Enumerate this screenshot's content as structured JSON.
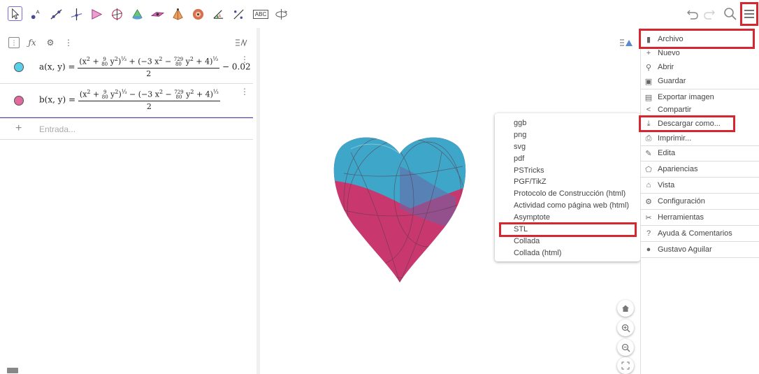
{
  "toolbar": {
    "tools": [
      "move-tool",
      "point-tool",
      "line-tool",
      "perpendicular-line-tool",
      "polygon-tool",
      "circle-axis-tool",
      "cone-tool",
      "plane-tool",
      "pyramid-tool",
      "sphere-tool",
      "angle-tool",
      "reflect-tool",
      "text-tool",
      "rotate-view-tool"
    ],
    "text_tool_label": "ABC"
  },
  "algebra": {
    "rows": [
      {
        "name": "a",
        "color": "#5ad0e8",
        "lhs": "a(x, y) =",
        "tail": "− 0.02"
      },
      {
        "name": "b",
        "color": "#e06aa0",
        "lhs": "b(x, y) =",
        "tail": ""
      }
    ],
    "input_placeholder": "Entrada..."
  },
  "submenu": {
    "items": [
      "ggb",
      "png",
      "svg",
      "pdf",
      "PSTricks",
      "PGF/TikZ",
      "Protocolo de Construcción (html)",
      "Actividad como página web (html)",
      "Asymptote",
      "STL",
      "Collada",
      "Collada (html)"
    ],
    "highlighted": "STL"
  },
  "menu": {
    "items": [
      {
        "label": "Archivo",
        "icon": "file-icon"
      },
      {
        "label": "Nuevo",
        "icon": "plus-icon"
      },
      {
        "label": "Abrir",
        "icon": "search-icon"
      },
      {
        "label": "Guardar",
        "icon": "save-icon"
      },
      {
        "label": "Exportar imagen",
        "icon": "image-icon"
      },
      {
        "label": "Compartir",
        "icon": "share-icon"
      },
      {
        "label": "Descargar como...",
        "icon": "download-icon"
      },
      {
        "label": "Imprimir...",
        "icon": "print-icon"
      },
      {
        "label": "Edita",
        "icon": "pencil-icon"
      },
      {
        "label": "Apariencias",
        "icon": "perspectives-icon"
      },
      {
        "label": "Vista",
        "icon": "home-icon"
      },
      {
        "label": "Configuración",
        "icon": "gear-icon"
      },
      {
        "label": "Herramientas",
        "icon": "tools-icon"
      },
      {
        "label": "Ayuda & Comentarios",
        "icon": "help-icon"
      },
      {
        "label": "Gustavo Aguilar",
        "icon": "user-icon"
      }
    ]
  },
  "colors": {
    "accent": "#7b6fd6",
    "highlight": "#d6262f",
    "heart_top": "#3ea6c8",
    "heart_bottom": "#c8386e"
  }
}
